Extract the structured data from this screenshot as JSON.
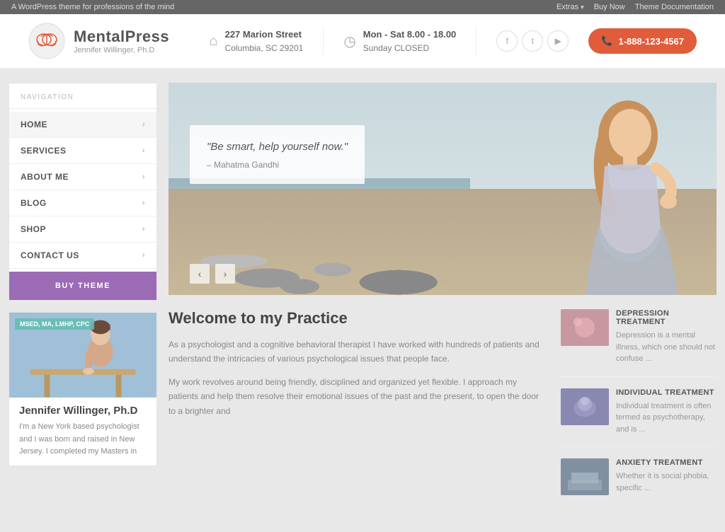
{
  "admin_bar": {
    "left_text": "A WordPress theme for professions of the mind",
    "extras_label": "Extras",
    "buy_now_label": "Buy Now",
    "theme_docs_label": "Theme Documentation"
  },
  "header": {
    "logo_name": "MentalPress",
    "logo_subtitle": "Jennifer Willinger, Ph.D",
    "address_line1": "227 Marion Street",
    "address_line2": "Columbia, SC 29201",
    "hours_line1": "Mon - Sat 8.00 - 18.00",
    "hours_line2": "Sunday CLOSED",
    "phone": "1-888-123-4567"
  },
  "sidebar": {
    "nav_label": "NAVIGATION",
    "nav_items": [
      {
        "label": "HOME"
      },
      {
        "label": "SERVICES"
      },
      {
        "label": "ABOUT ME"
      },
      {
        "label": "BLOG"
      },
      {
        "label": "SHOP"
      },
      {
        "label": "CONTACT US"
      }
    ],
    "buy_theme_label": "BUY THEME",
    "profile_badge": "MSED, MA, LMHP, CPC",
    "profile_name": "Jennifer Willinger, Ph.D",
    "profile_bio": "I'm a New York based psychologist and I was born and raised in New Jersey. I completed my Masters in"
  },
  "slider": {
    "quote": "\"Be smart, help yourself now.\"",
    "quote_author": "– Mahatma Gandhi"
  },
  "main_content": {
    "welcome_title": "Welcome to my Practice",
    "para1": "As a psychologist and a cognitive behavioral therapist I have worked with hundreds of patients and understand the intricacies of various psychological issues that people face.",
    "para2": "My work revolves around being friendly, disciplined and organized yet flexible. I approach my patients and help them resolve their emotional issues of the past and the present, to open the door to a brighter and"
  },
  "treatments": [
    {
      "title": "DEPRESSION TREATMENT",
      "desc": "Depression is a mental illness, which one should not confuse ..."
    },
    {
      "title": "INDIVIDUAL TREATMENT",
      "desc": "Individual treatment is often termed as psychotherapy, and is ..."
    },
    {
      "title": "ANXIETY TREATMENT",
      "desc": "Whether it is social phobia, specific ..."
    }
  ]
}
